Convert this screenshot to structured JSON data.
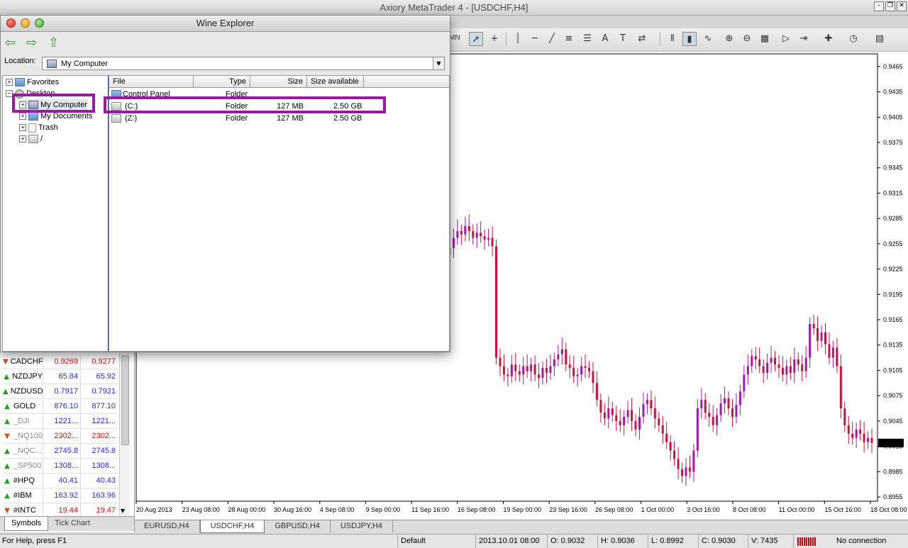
{
  "main_window": {
    "title": "Axiory MetaTrader 4 - [USDCHF,H4]",
    "mdi_buttons": [
      "–",
      "❐",
      "✕"
    ]
  },
  "toolbar": {
    "timeframe_partial": "MN",
    "tools": [
      "cursor-icon",
      "crosshair-icon",
      "vertical-line-icon",
      "horizontal-line-icon",
      "trendline-icon",
      "channel-icon",
      "fibonacci-icon",
      "text-icon",
      "label-icon",
      "arrows-icon",
      "bar-chart-icon",
      "candlestick-icon",
      "line-chart-icon",
      "zoom-in-icon",
      "zoom-out-icon",
      "tile-windows-icon",
      "autoscroll-icon",
      "indicators-icon",
      "periods-icon",
      "templates-icon"
    ]
  },
  "wine_explorer": {
    "title": "Wine Explorer",
    "location_label": "Location:",
    "location_value": "My Computer",
    "tree": [
      {
        "label": "Favorites",
        "expander": "+",
        "icon": "folder"
      },
      {
        "label": "Desktop",
        "expander": "−",
        "icon": "desktop"
      },
      {
        "label": "My Computer",
        "expander": "+",
        "icon": "computer"
      },
      {
        "label": "My Documents",
        "expander": "+",
        "icon": "folder"
      },
      {
        "label": "Trash",
        "expander": "+",
        "icon": "trash"
      },
      {
        "label": "/",
        "expander": "+",
        "icon": "drive"
      }
    ],
    "columns": [
      "File",
      "Type",
      "Size",
      "Size available"
    ],
    "files": [
      {
        "name": "Control Panel",
        "type": "Folder",
        "size": "",
        "available": ""
      },
      {
        "name": "(C:)",
        "type": "Folder",
        "size": "127 MB",
        "available": "2.50 GB"
      },
      {
        "name": "(Z:)",
        "type": "Folder",
        "size": "127 MB",
        "available": "2.50 GB"
      }
    ]
  },
  "market_watch": {
    "rows": [
      {
        "symbol": "CADCHF",
        "bid": "0.9269",
        "ask": "0.9277",
        "dir": "down"
      },
      {
        "symbol": "NZDJPY",
        "bid": "65.84",
        "ask": "65.92",
        "dir": "up"
      },
      {
        "symbol": "NZDUSD",
        "bid": "0.7917",
        "ask": "0.7921",
        "dir": "up"
      },
      {
        "symbol": "GOLD",
        "bid": "876.10",
        "ask": "877.10",
        "dir": "up"
      },
      {
        "symbol": "_DJI",
        "bid": "1221...",
        "ask": "1221...",
        "dir": "up",
        "dim": true
      },
      {
        "symbol": "_NQ100",
        "bid": "2302...",
        "ask": "2302...",
        "dir": "down",
        "dim": true
      },
      {
        "symbol": "_NQC...",
        "bid": "2745.8",
        "ask": "2745.8",
        "dir": "up",
        "dim": true
      },
      {
        "symbol": "_SP500",
        "bid": "1308...",
        "ask": "1308...",
        "dir": "up",
        "dim": true
      },
      {
        "symbol": "#HPQ",
        "bid": "40.41",
        "ask": "40.43",
        "dir": "up"
      },
      {
        "symbol": "#IBM",
        "bid": "163.92",
        "ask": "163.96",
        "dir": "up"
      },
      {
        "symbol": "#INTC",
        "bid": "19.44",
        "ask": "19.47",
        "dir": "down"
      }
    ],
    "tabs": [
      "Symbols",
      "Tick Chart"
    ]
  },
  "chart_tabs": [
    "EURUSD,H4",
    "USDCHF,H4",
    "GBPUSD,H4",
    "USDJPY,H4"
  ],
  "chart_tab_selected": "USDCHF,H4",
  "status_bar": {
    "help": "For Help, press F1",
    "profile": "Default",
    "datetime": "2013.10.01 08:00",
    "open": "O: 0.9032",
    "high": "H: 0.9036",
    "low": "L: 0.8992",
    "close": "C: 0.9030",
    "volume": "V: 7435",
    "connection": "No connection"
  },
  "chart_data": {
    "type": "bar",
    "symbol": "USDCHF",
    "timeframe": "H4",
    "current_price": "0.9019",
    "price_axis": [
      "0.9465",
      "0.9435",
      "0.9405",
      "0.9375",
      "0.9345",
      "0.9315",
      "0.9285",
      "0.9255",
      "0.9225",
      "0.9195",
      "0.9165",
      "0.9135",
      "0.9105",
      "0.9075",
      "0.9045",
      "0.9015",
      "0.8985",
      "0.8955"
    ],
    "ylim": [
      0.895,
      0.948
    ],
    "time_axis": [
      "20 Aug 2013",
      "23 Aug 08:00",
      "28 Aug 00:00",
      "30 Aug 16:00",
      "4 Sep 08:00",
      "9 Sep 00:00",
      "11 Sep 16:00",
      "16 Sep 08:00",
      "19 Sep 00:00",
      "23 Sep 16:00",
      "26 Sep 08:00",
      "1 Oct 00:00",
      "3 Oct 16:00",
      "8 Oct 08:00",
      "11 Oct 00:00",
      "15 Oct 16:00",
      "18 Oct 08:00"
    ],
    "up_color": "#a01aa8",
    "down_color": "#c8143c",
    "close_series": [
      0.925,
      0.9262,
      0.927,
      0.9266,
      0.9276,
      0.927,
      0.9262,
      0.9268,
      0.9264,
      0.926,
      0.9262,
      0.9252,
      0.912,
      0.911,
      0.91,
      0.9098,
      0.9112,
      0.9104,
      0.91,
      0.911,
      0.9104,
      0.9112,
      0.91,
      0.9096,
      0.9108,
      0.9102,
      0.911,
      0.9118,
      0.9124,
      0.913,
      0.9112,
      0.9108,
      0.9098,
      0.91,
      0.911,
      0.9108,
      0.9104,
      0.909,
      0.907,
      0.9055,
      0.9048,
      0.906,
      0.9052,
      0.9045,
      0.904,
      0.905,
      0.9058,
      0.9045,
      0.9035,
      0.905,
      0.9065,
      0.907,
      0.906,
      0.9048,
      0.904,
      0.903,
      0.902,
      0.901,
      0.9,
      0.8988,
      0.898,
      0.899,
      0.8985,
      0.901,
      0.906,
      0.907,
      0.9055,
      0.905,
      0.904,
      0.9052,
      0.9066,
      0.9072,
      0.906,
      0.905,
      0.9064,
      0.908,
      0.91,
      0.911,
      0.9122,
      0.9118,
      0.911,
      0.9102,
      0.9114,
      0.912,
      0.9112,
      0.9108,
      0.91,
      0.911,
      0.9102,
      0.9118,
      0.9112,
      0.9104,
      0.912,
      0.916,
      0.9155,
      0.914,
      0.915,
      0.9136,
      0.912,
      0.9132,
      0.911,
      0.906,
      0.904,
      0.903,
      0.9025,
      0.9035,
      0.903,
      0.902,
      0.9025,
      0.9019
    ]
  }
}
